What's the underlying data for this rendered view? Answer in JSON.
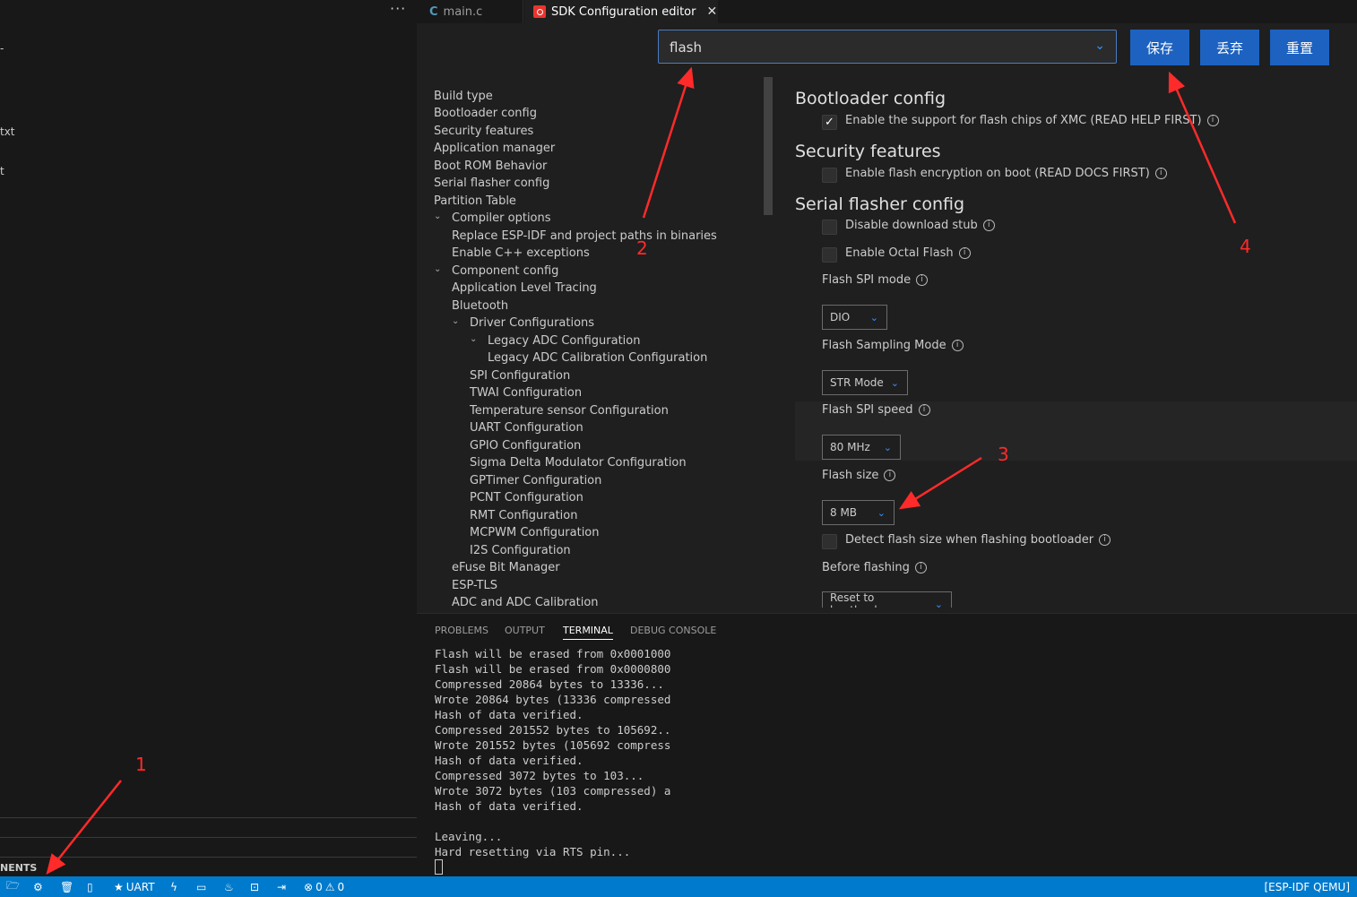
{
  "sidebar": {
    "more_label": "···",
    "fragments": [
      "-",
      "txt",
      "t"
    ],
    "components_label": "NENTS"
  },
  "tabs": [
    {
      "icon": "C",
      "label": "main.c"
    },
    {
      "label": "SDK Configuration editor",
      "close": "✕"
    }
  ],
  "search": {
    "value": "flash",
    "chevron": "⌄"
  },
  "actions": {
    "save": "保存",
    "discard": "丢弃",
    "reset": "重置"
  },
  "nav": {
    "items": [
      "Build type",
      "Bootloader config",
      "Security features",
      "Application manager",
      "Boot ROM Behavior",
      "Serial flasher config",
      "Partition Table",
      "Compiler options",
      "Replace ESP-IDF and project paths in binaries",
      "Enable C++ exceptions",
      "Component config",
      "Application Level Tracing",
      "Bluetooth",
      "Driver Configurations",
      "Legacy ADC Configuration",
      "Legacy ADC Calibration Configuration",
      "SPI Configuration",
      "TWAI Configuration",
      "Temperature sensor Configuration",
      "UART Configuration",
      "GPIO Configuration",
      "Sigma Delta Modulator Configuration",
      "GPTimer Configuration",
      "PCNT Configuration",
      "RMT Configuration",
      "MCPWM Configuration",
      "I2S Configuration",
      "eFuse Bit Manager",
      "ESP-TLS",
      "ADC and ADC Calibration"
    ],
    "chevron": "⌄"
  },
  "settings": {
    "bootloader_title": "Bootloader config",
    "xmc_label": "Enable the support for flash chips of XMC (READ HELP FIRST)",
    "xmc_checked": "✓",
    "security_title": "Security features",
    "encryption_label": "Enable flash encryption on boot (READ DOCS FIRST)",
    "serial_title": "Serial flasher config",
    "download_stub_label": "Disable download stub",
    "octal_flash_label": "Enable Octal Flash",
    "spi_mode_label": "Flash SPI mode",
    "spi_mode_value": "DIO",
    "sampling_mode_label": "Flash Sampling Mode",
    "sampling_mode_value": "STR Mode",
    "spi_speed_label": "Flash SPI speed",
    "spi_speed_value": "80 MHz",
    "flash_size_label": "Flash size",
    "flash_size_value": "8 MB",
    "detect_size_label": "Detect flash size when flashing bootloader",
    "before_flashing_label": "Before flashing",
    "before_flashing_value": "Reset to bootloader",
    "info_glyph": "i",
    "chevron": "⌄"
  },
  "panel": {
    "tabs": [
      "PROBLEMS",
      "OUTPUT",
      "TERMINAL",
      "DEBUG CONSOLE"
    ],
    "terminal_lines": [
      "Flash will be erased from 0x0001000",
      "Flash will be erased from 0x0000800",
      "Compressed 20864 bytes to 13336...",
      "Wrote 20864 bytes (13336 compressed",
      "Hash of data verified.",
      "Compressed 201552 bytes to 105692..",
      "Wrote 201552 bytes (105692 compress",
      "Hash of data verified.",
      "Compressed 3072 bytes to 103...",
      "Wrote 3072 bytes (103 compressed) a",
      "Hash of data verified.",
      "",
      "Leaving...",
      "Hard resetting via RTS pin..."
    ]
  },
  "statusbar": {
    "uart_label": "UART",
    "errors": "0",
    "warnings": "0",
    "right_label": "[ESP-IDF QEMU]"
  },
  "annotations": [
    "1",
    "2",
    "3",
    "4"
  ],
  "colors": {
    "accent": "#1d62c0",
    "statusbar": "#007acc",
    "annotation": "#ff2a2a"
  }
}
